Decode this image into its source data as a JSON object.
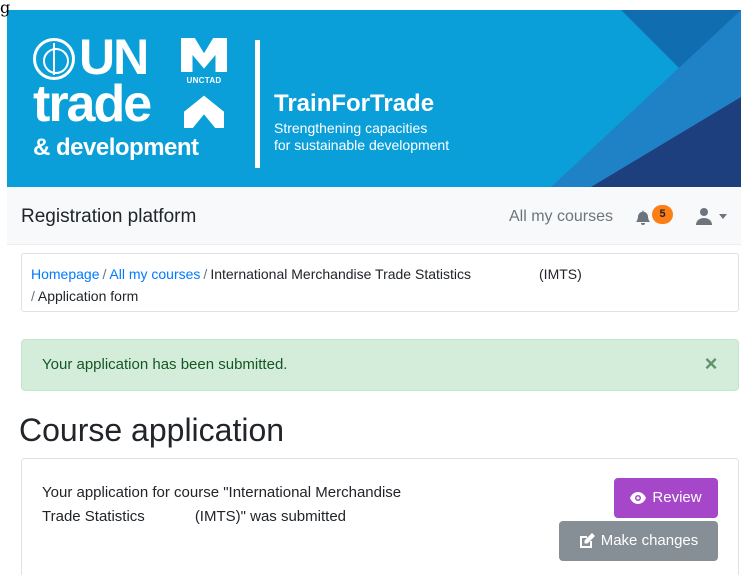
{
  "corner_glyph": "g",
  "banner": {
    "un_text": "UN",
    "trade_text": "trade",
    "dev_text": "& development",
    "unctad_label": "UNCTAD",
    "program_title": "TrainForTrade",
    "program_subtitle_line1": "Strengthening capacities",
    "program_subtitle_line2": "for sustainable development",
    "colors": {
      "primary": "#0a9fd9",
      "dark": "#1d3f7d",
      "mid": "#1f82c6"
    }
  },
  "navbar": {
    "brand": "Registration platform",
    "courses_link": "All my courses",
    "notification_count": "5",
    "icons": {
      "bell": "bell-icon",
      "user": "user-icon",
      "caret": "caret-down-icon"
    }
  },
  "breadcrumb": {
    "home": "Homepage",
    "separator": "/",
    "courses": "All my courses",
    "course": "International Merchandise Trade Statistics",
    "course_code": "(IMTS)",
    "current": "Application form"
  },
  "alert": {
    "message": "Your application has been submitted.",
    "close": "×",
    "colors": {
      "bg": "#d4edda",
      "text": "#155724"
    }
  },
  "page": {
    "heading": "Course application"
  },
  "card": {
    "line1": "Your application for course \"International Merchandise",
    "line2_a": "Trade Statistics",
    "line2_b": "(IMTS)\" was submitted",
    "review_label": "Review",
    "changes_label": "Make changes",
    "icons": {
      "review": "eye-icon",
      "changes": "edit-icon"
    },
    "colors": {
      "review": "#a547c8",
      "changes": "#868e96"
    }
  }
}
